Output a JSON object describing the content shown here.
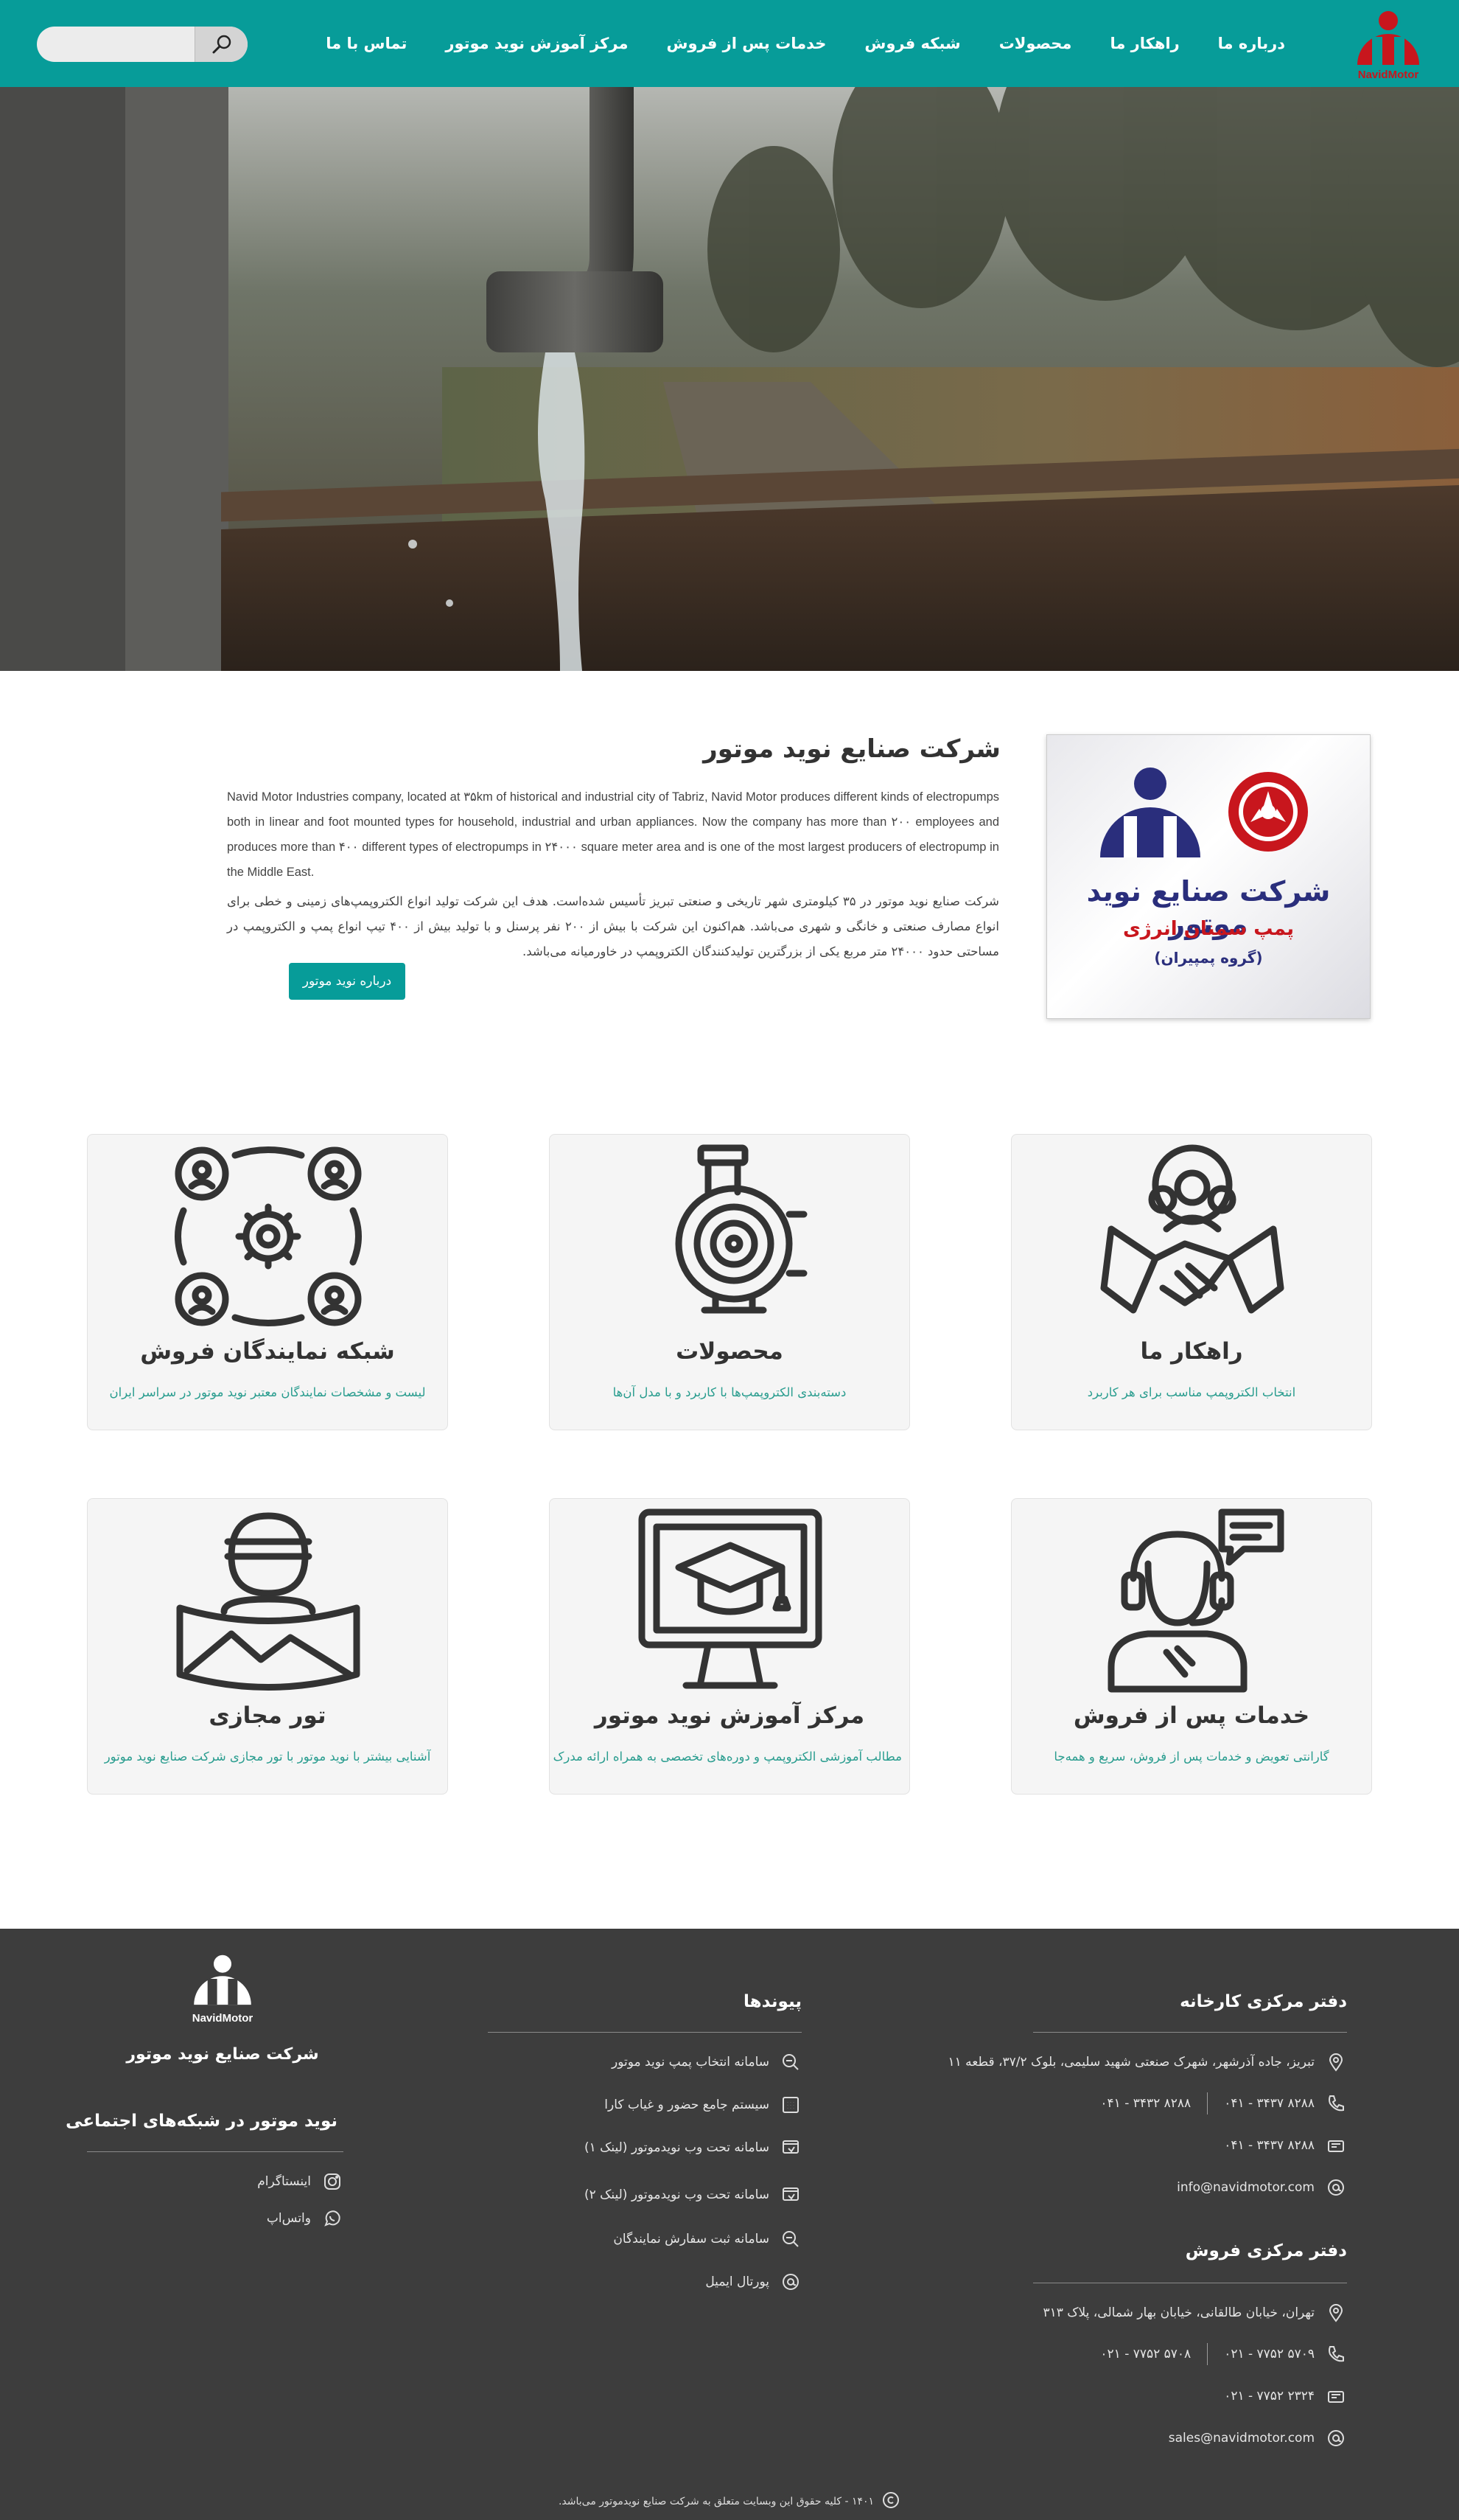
{
  "header": {
    "logo_text": "NavidMotor",
    "nav": [
      {
        "label": "درباره ما"
      },
      {
        "label": "راهکار ما"
      },
      {
        "label": "محصولات"
      },
      {
        "label": "شبکه فروش"
      },
      {
        "label": "خدمات پس از فروش"
      },
      {
        "label": "مرکز آموزش نوید موتور"
      },
      {
        "label": "تماس با ما"
      }
    ],
    "search_value": "",
    "search_placeholder": ""
  },
  "about": {
    "title": "شرکت صنایع نوید موتور",
    "text_en": "Navid Motor Industries company, located at ۳۵km of historical and industrial city of Tabriz, Navid Motor produces different kinds of electropumps both in linear and foot mounted types for household, industrial and urban appliances. Now the company has more than ۲۰۰ employees and produces more than ۴۰۰ different types of electropumps in ۲۴۰۰۰ square meter area and is one of the most largest producers of electropump in the Middle East.",
    "text_fa": "شرکت صنایع نوید موتور در ۳۵ کیلومتری شهر تاریخی و صنعتی تبریز تأسیس شده‌است. هدف این شرکت تولید انواع الکتروپمپ‌های زمینی و خطی برای انواع مصارف صنعتی و خانگی و شهری می‌باشد. هم‌اکنون این شرکت با بیش از ۲۰۰ نفر پرسنل و با تولید بیش از ۴۰۰ تیپ انواع پمپ و الکتروپمپ در مساحتی حدود ۲۴۰۰۰ متر مربع یکی از بزرگترین تولیدکنندگان الکتروپمپ در خاورمیانه می‌باشد.",
    "button": "درباره نوید موتور",
    "image_title": "شرکت صنایع نوید موتور",
    "image_subtitle": "پمپ سمنان انرژی",
    "image_group": "(گروه پمپیران)"
  },
  "cards": [
    {
      "title": "راهکار ما",
      "desc": "انتخاب الکتروپمپ مناسب برای هر کاربرد",
      "icon": "handshake-team-icon"
    },
    {
      "title": "محصولات",
      "desc": "دسته‌بندی الکتروپمپ‌ها با کاربرد و با مدل آن‌ها",
      "icon": "pump-icon"
    },
    {
      "title": "شبکه نمایندگان فروش",
      "desc": "لیست و مشخصات نمایندگان معتبر نوید موتور در سراسر  ایران",
      "icon": "network-icon"
    },
    {
      "title": "خدمات پس از فروش",
      "desc": "گارانتی تعویض و خدمات پس از فروش، سریع و همه‌جا",
      "icon": "support-agent-icon"
    },
    {
      "title": "مرکز آموزش نوید موتور",
      "desc": "مطالب آموزشی الکتروپمپ و دوره‌های تخصصی به همراه ارائه مدرک",
      "icon": "education-monitor-icon"
    },
    {
      "title": "تور مجازی",
      "desc": "آشنایی بیشتر با نوید موتور با تور مجازی شرکت صنایع نوید موتور",
      "icon": "virtual-tour-icon"
    }
  ],
  "footer": {
    "factory": {
      "title": "دفتر مرکزی کارخانه",
      "address": "تبریز، جاده آذرشهر، شهرک صنعتی شهید سلیمی، بلوک ۳۷/۲، قطعه ۱۱",
      "phone1": "۰۴۱ - ۳۴۳۷ ۸۲۸۸",
      "phone2": "۰۴۱ - ۳۴۳۲ ۸۲۸۸",
      "fax": "۰۴۱ - ۳۴۳۷ ۸۲۸۸",
      "email": "info@navidmotor.com"
    },
    "sales": {
      "title": "دفتر مرکزی فروش",
      "address": "تهران، خیابان طالقانی، خیابان بهار شمالی، پلاک ۳۱۳",
      "phone1": "۰۲۱ - ۷۷۵۲ ۵۷۰۹",
      "phone2": "۰۲۱ - ۷۷۵۲ ۵۷۰۸",
      "fax": "۰۲۱ - ۷۷۵۲ ۲۳۲۴",
      "email": "sales@navidmotor.com"
    },
    "links_title": "پیوندها",
    "links": [
      {
        "label": "سامانه انتخاب پمپ نوید موتور"
      },
      {
        "label": "سیستم جامع حضور و غیاب کارا"
      },
      {
        "label": "سامانه تحت وب نویدموتور (لینک ۱)"
      },
      {
        "label": "سامانه تحت وب نویدموتور (لینک ۲)"
      },
      {
        "label": "سامانه ثبت سفارش نمایندگان"
      },
      {
        "label": "پورتال ایمیل"
      }
    ],
    "logo_text": "NavidMotor",
    "company": "شرکت صنایع نوید موتور",
    "social_title": "نوید موتور در شبکه‌های اجتماعی",
    "social": [
      {
        "label": "اینستاگرام"
      },
      {
        "label": "واتس‌اپ"
      }
    ],
    "copyright": "۱۴۰۱ - کلیه حقوق این وبسایت متعلق به شرکت صنایع نویدموتور می‌باشد."
  },
  "colors": {
    "primary": "#079c99",
    "accent_red": "#c8161d",
    "brand_blue": "#2a2e7c",
    "footer_bg": "#3d3d3d"
  }
}
